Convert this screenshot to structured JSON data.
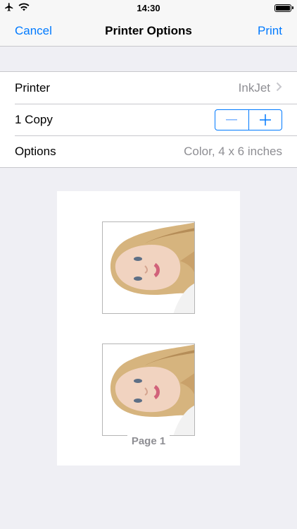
{
  "status_bar": {
    "time": "14:30",
    "airplane_icon": "airplane-icon",
    "wifi_icon": "wifi-icon",
    "battery_icon": "battery-icon"
  },
  "nav": {
    "cancel_label": "Cancel",
    "title": "Printer Options",
    "print_label": "Print"
  },
  "options": {
    "printer_label": "Printer",
    "printer_value": "InkJet",
    "copies_label": "1 Copy",
    "stepper_minus": "−",
    "stepper_plus": "+",
    "options_label": "Options",
    "options_value": "Color, 4 x 6 inches"
  },
  "preview": {
    "page_label": "Page 1"
  },
  "colors": {
    "accent": "#007aff",
    "background": "#efeff4",
    "secondary_text": "#8e8e93"
  }
}
